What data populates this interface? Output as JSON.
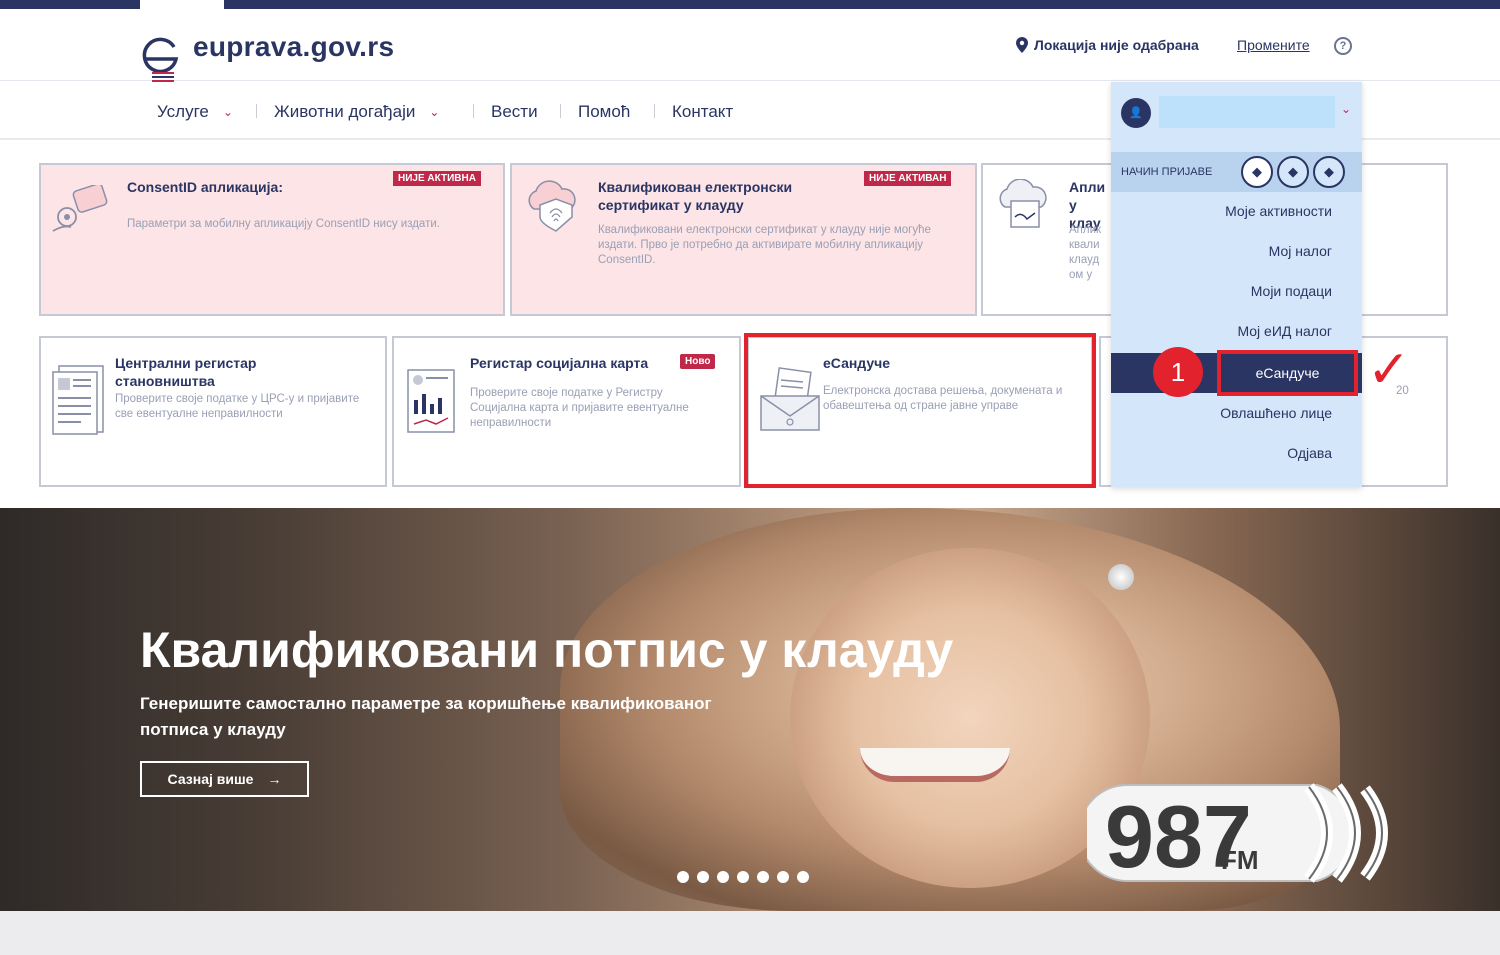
{
  "site": {
    "logo_text": "euprava.gov.rs",
    "location_text": "Локација није одабрана",
    "location_change": "Промените",
    "help_symbol": "?"
  },
  "nav": {
    "items": [
      {
        "label": "Услуге",
        "has_dropdown": true
      },
      {
        "label": "Животни догађаји",
        "has_dropdown": true
      },
      {
        "label": "Вести",
        "has_dropdown": false
      },
      {
        "label": "Помоћ",
        "has_dropdown": false
      },
      {
        "label": "Контакт",
        "has_dropdown": false
      }
    ],
    "chevron": "⌄"
  },
  "cards_row1": [
    {
      "title": "ConsentID апликација:",
      "desc": "Параметри за мобилну апликацију ConsentID нису издати.",
      "badge": "НИЈЕ АКТИВНА",
      "status": "inactive",
      "icon": "mobile-key-icon"
    },
    {
      "title": "Квалификован електронски сертификат у клауду",
      "desc": "Квалификовани електронски сертификат у клауду није могуће издати. Прво је потребно да активирате мобилну апликацију ConsentID.",
      "badge": "НИЈЕ АКТИВАН",
      "status": "inactive",
      "icon": "cloud-fingerprint-icon"
    },
    {
      "title": "Апли у клау",
      "desc": "Аплик квали клауд ом у",
      "badge": "",
      "status": "normal",
      "icon": "cloud-document-icon"
    }
  ],
  "cards_row2": [
    {
      "title": "Централни регистар становништва",
      "desc": "Проверите своје податке у ЦРС-у и пријавите све евентуалне неправилности",
      "badge": "",
      "icon": "registry-document-icon"
    },
    {
      "title": "Регистар социјална карта",
      "desc": "Проверите своје податке у Регистру Социјална карта и пријавите евентуалне неправилности",
      "badge": "Ново",
      "icon": "chart-document-icon"
    },
    {
      "title": "еСандуче",
      "desc": "Електронска достава решења, докумената и обавештења од стране јавне управе",
      "badge": "",
      "icon": "mail-envelope-icon",
      "highlighted": true
    },
    {
      "title": "",
      "desc": "20",
      "badge": "",
      "icon": ""
    }
  ],
  "dropdown": {
    "avatar_symbol": "👤",
    "login_label": "НАЧИН ПРИЈАВЕ",
    "login_levels": [
      "◆",
      "◆",
      "◆"
    ],
    "items": [
      "Моје активности",
      "Мој налог",
      "Моји подаци",
      "Мој еИД налог",
      "еСандуче",
      "Овлашћено лице",
      "Одјава"
    ],
    "active_item": "еСандуче"
  },
  "annotation": {
    "step_number": "1",
    "checkmark": "✓"
  },
  "hero": {
    "title": "Квалификовани потпис у клауду",
    "subtitle": "Генеришите самостално параметре за коришћење квалификованог потписа у клауду",
    "button_label": "Сазнај више",
    "button_arrow": "→",
    "slides_count": 7
  },
  "watermark": {
    "number": "987",
    "unit": "FM"
  },
  "colors": {
    "brand_navy": "#2a3563",
    "accent_red": "#c0284a",
    "highlight_red": "#e2222d",
    "inactive_pink": "#fde4e6",
    "dropdown_blue": "#d4e6f9"
  }
}
